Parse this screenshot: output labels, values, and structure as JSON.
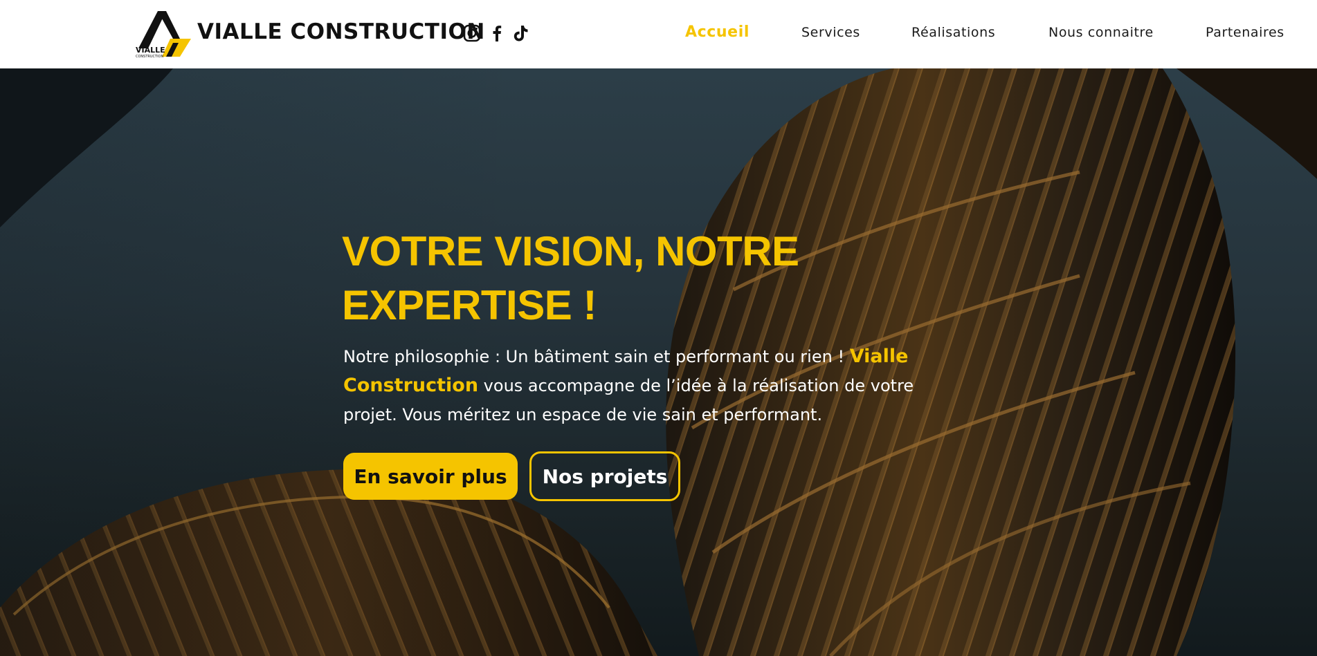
{
  "header": {
    "brand": "VIALLE CONSTRUCTION",
    "logo_text": "VIALLE",
    "logo_subtext": "CONSTRUCTION",
    "social": [
      {
        "icon": "instagram-icon"
      },
      {
        "icon": "facebook-icon"
      },
      {
        "icon": "tiktok-icon"
      }
    ]
  },
  "nav": {
    "items": [
      {
        "label": "Accueil",
        "active": true
      },
      {
        "label": "Services",
        "active": false
      },
      {
        "label": "Réalisations",
        "active": false
      },
      {
        "label": "Nous connaitre",
        "active": false
      },
      {
        "label": "Partenaires",
        "active": false
      }
    ]
  },
  "hero": {
    "title_line1": "VOTRE VISION, NOTRE",
    "title_line2": "EXPERTISE !",
    "text_part1": "Notre philosophie : Un bâtiment sain et performant ou rien ! ",
    "text_highlight": "Vialle Construction",
    "text_part2": " vous accompagne de l’idée à la réalisation de votre projet. Vous méritez un espace de vie sain et performant.",
    "primary_button": "En savoir plus",
    "secondary_button": "Nos projets"
  },
  "colors": {
    "accent": "#f5c400",
    "header_bg": "#ffffff",
    "hero_text": "#ffffff",
    "nav_text": "#1a1a1a"
  }
}
